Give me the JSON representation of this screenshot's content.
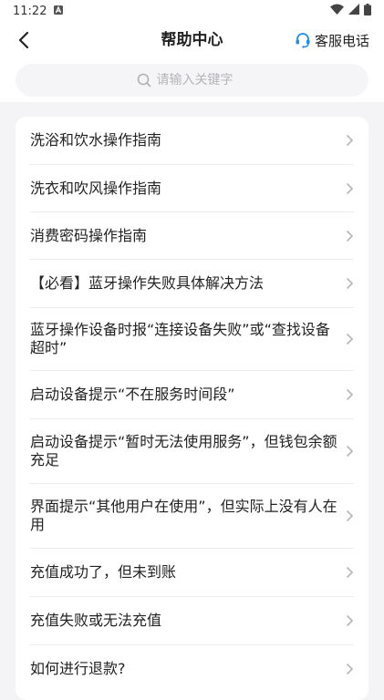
{
  "status_bar": {
    "time": "11:22",
    "notification_icon": "a-icon",
    "icons": [
      "wifi-icon",
      "signal-icon",
      "battery-icon"
    ]
  },
  "nav": {
    "back_icon": "chevron-left-icon",
    "title": "帮助中心",
    "service_icon": "headset-icon",
    "service_label": "客服电话",
    "service_icon_color": "#1e8cf0"
  },
  "search": {
    "icon": "search-icon",
    "placeholder": "请输入关键字",
    "value": ""
  },
  "list": {
    "items": [
      {
        "label": "洗浴和饮水操作指南"
      },
      {
        "label": "洗衣和吹风操作指南"
      },
      {
        "label": "消费密码操作指南"
      },
      {
        "label": "【必看】蓝牙操作失败具体解决方法"
      },
      {
        "label": "蓝牙操作设备时报“连接设备失败”或“查找设备超时”"
      },
      {
        "label": "启动设备提示“不在服务时间段”"
      },
      {
        "label": "启动设备提示“暂时无法使用服务”，但钱包余额充足"
      },
      {
        "label": "界面提示“其他用户在使用”，但实际上没有人在用"
      },
      {
        "label": "充值成功了，但未到账"
      },
      {
        "label": "充值失败或无法充值"
      },
      {
        "label": "如何进行退款?"
      }
    ]
  }
}
